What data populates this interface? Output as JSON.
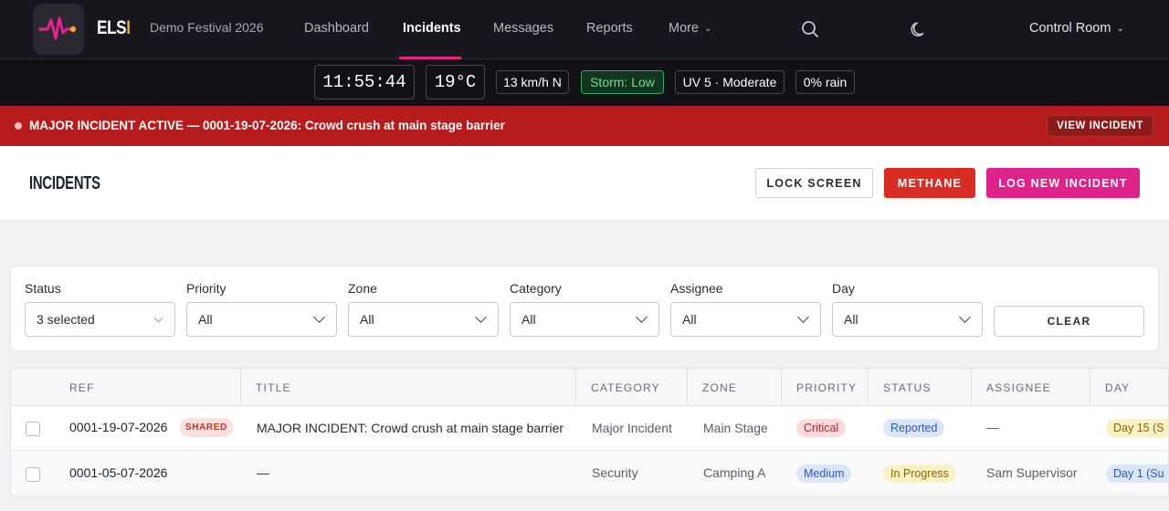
{
  "app": {
    "brand": "ELS",
    "brand_accent": "I",
    "event": "Demo Festival 2026",
    "room": "Control Room"
  },
  "nav": {
    "items": [
      {
        "label": "Dashboard"
      },
      {
        "label": "Incidents",
        "active": true
      },
      {
        "label": "Messages"
      },
      {
        "label": "Reports"
      },
      {
        "label": "More"
      }
    ]
  },
  "status": {
    "time": "11:55:44",
    "temp": "19°C",
    "wind": "13 km/h N",
    "storm": "Storm: Low",
    "uv": "UV 5 · Moderate",
    "rain": "0% rain"
  },
  "alert": {
    "text": "MAJOR INCIDENT ACTIVE — 0001-19-07-2026: Crowd crush at main stage barrier",
    "button": "VIEW INCIDENT"
  },
  "header": {
    "title": "INCIDENTS",
    "lock": "LOCK SCREEN",
    "methane": "METHANE",
    "log": "LOG NEW INCIDENT"
  },
  "filters": {
    "status": {
      "label": "Status",
      "value": "3 selected"
    },
    "priority": {
      "label": "Priority",
      "value": "All"
    },
    "zone": {
      "label": "Zone",
      "value": "All"
    },
    "category": {
      "label": "Category",
      "value": "All"
    },
    "assignee": {
      "label": "Assignee",
      "value": "All"
    },
    "day": {
      "label": "Day",
      "value": "All"
    },
    "clear": "CLEAR"
  },
  "table": {
    "headers": {
      "ref": "REF",
      "title": "TITLE",
      "category": "CATEGORY",
      "zone": "ZONE",
      "priority": "PRIORITY",
      "status": "STATUS",
      "assignee": "ASSIGNEE",
      "day": "DAY"
    },
    "rows": [
      {
        "ref": "0001-19-07-2026",
        "tag": "SHARED",
        "title": "MAJOR INCIDENT: Crowd crush at main stage barrier",
        "category": "Major Incident",
        "zone": "Main Stage",
        "priority": "Critical",
        "status": "Reported",
        "assignee": "—",
        "day": "Day 15 (S"
      },
      {
        "ref": "0001-05-07-2026",
        "title": "—",
        "category": "Security",
        "zone": "Camping A",
        "priority": "Medium",
        "status": "In Progress",
        "assignee": "Sam Supervisor",
        "day": "Day 1 (Su"
      }
    ]
  },
  "colors": {
    "accent": "#e0228b",
    "alert": "#b71c1c",
    "methane": "#d92c25",
    "brand_accent": "#f5a623"
  }
}
